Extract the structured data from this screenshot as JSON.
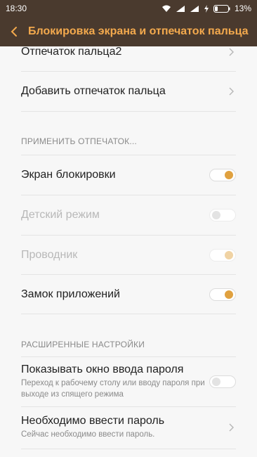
{
  "status_bar": {
    "time": "18:30",
    "battery_percent": "13%"
  },
  "header": {
    "title": "Блокировка экрана и отпечаток пальца"
  },
  "items": {
    "fingerprint2": {
      "label": "Отпечаток пальца2"
    },
    "add_fingerprint": {
      "label": "Добавить отпечаток пальца"
    }
  },
  "section_apply": {
    "header": "ПРИМЕНИТЬ ОТПЕЧАТОК...",
    "toggles": [
      {
        "label": "Экран блокировки",
        "state": "on",
        "enabled": true
      },
      {
        "label": "Детский режим",
        "state": "off",
        "enabled": false
      },
      {
        "label": "Проводник",
        "state": "on",
        "enabled": false
      },
      {
        "label": "Замок приложений",
        "state": "on",
        "enabled": true
      }
    ]
  },
  "section_advanced": {
    "header": "РАСШИРЕННЫЕ НАСТРОЙКИ",
    "show_password": {
      "label": "Показывать окно ввода пароля",
      "description": "Переход к рабочему столу или вводу пароля при выходе из спящего режима",
      "state": "off"
    },
    "require_password": {
      "label": "Необходимо ввести пароль",
      "description": "Сейчас необходимо ввести пароль."
    }
  },
  "colors": {
    "accent": "#e0a13f",
    "title_bar": "#4a3a2e",
    "title_text": "#f3a94d"
  }
}
